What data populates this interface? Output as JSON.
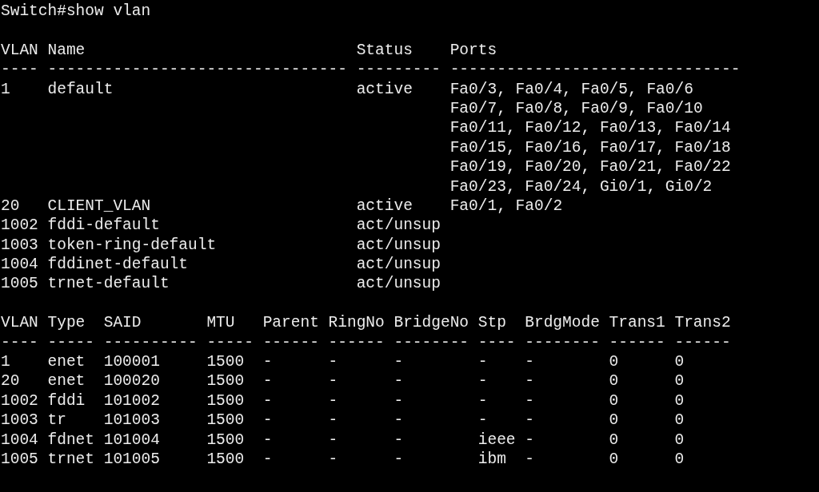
{
  "command": "Switch#show vlan",
  "vlan_table": {
    "columns": [
      "VLAN",
      "Name",
      "Status",
      "Ports"
    ],
    "rules": [
      "----",
      "--------------------------------",
      "---------",
      "-------------------------------"
    ],
    "rows": [
      {
        "vlan": "1",
        "name": "default",
        "status": "active",
        "ports": [
          "Fa0/3, Fa0/4, Fa0/5, Fa0/6",
          "Fa0/7, Fa0/8, Fa0/9, Fa0/10",
          "Fa0/11, Fa0/12, Fa0/13, Fa0/14",
          "Fa0/15, Fa0/16, Fa0/17, Fa0/18",
          "Fa0/19, Fa0/20, Fa0/21, Fa0/22",
          "Fa0/23, Fa0/24, Gi0/1, Gi0/2"
        ]
      },
      {
        "vlan": "20",
        "name": "CLIENT_VLAN",
        "status": "active",
        "ports": [
          "Fa0/1, Fa0/2"
        ]
      },
      {
        "vlan": "1002",
        "name": "fddi-default",
        "status": "act/unsup"
      },
      {
        "vlan": "1003",
        "name": "token-ring-default",
        "status": "act/unsup"
      },
      {
        "vlan": "1004",
        "name": "fddinet-default",
        "status": "act/unsup"
      },
      {
        "vlan": "1005",
        "name": "trnet-default",
        "status": "act/unsup"
      }
    ]
  },
  "type_table": {
    "columns": [
      "VLAN",
      "Type",
      "SAID",
      "MTU",
      "Parent",
      "RingNo",
      "BridgeNo",
      "Stp",
      "BrdgMode",
      "Trans1",
      "Trans2"
    ],
    "rules": [
      "----",
      "-----",
      "----------",
      "-----",
      "------",
      "------",
      "--------",
      "----",
      "--------",
      "------",
      "------"
    ],
    "rows": [
      [
        "1",
        "enet",
        "100001",
        "1500",
        "-",
        "-",
        "-",
        "-",
        "-",
        "0",
        "0"
      ],
      [
        "20",
        "enet",
        "100020",
        "1500",
        "-",
        "-",
        "-",
        "-",
        "-",
        "0",
        "0"
      ],
      [
        "1002",
        "fddi",
        "101002",
        "1500",
        "-",
        "-",
        "-",
        "-",
        "-",
        "0",
        "0"
      ],
      [
        "1003",
        "tr",
        "101003",
        "1500",
        "-",
        "-",
        "-",
        "-",
        "-",
        "0",
        "0"
      ],
      [
        "1004",
        "fdnet",
        "101004",
        "1500",
        "-",
        "-",
        "-",
        "ieee",
        "-",
        "0",
        "0"
      ],
      [
        "1005",
        "trnet",
        "101005",
        "1500",
        "-",
        "-",
        "-",
        "ibm",
        "-",
        "0",
        "0"
      ]
    ]
  }
}
